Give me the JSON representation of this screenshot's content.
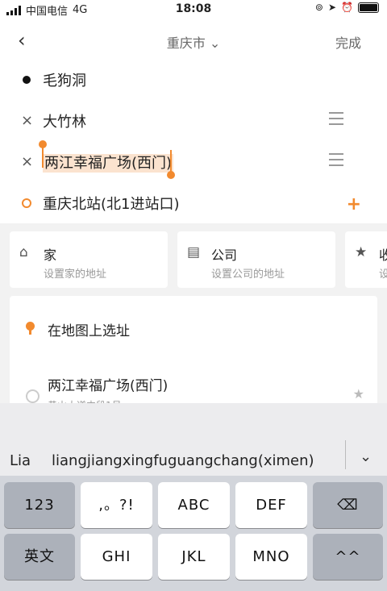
{
  "status_bar": {
    "carrier": "中国电信",
    "network": "4G",
    "time": "18:08"
  },
  "header": {
    "back_icon": "chevron-left-icon",
    "city": "重庆市",
    "city_chevron": "⌄",
    "done_label": "完成"
  },
  "route": {
    "origin": "毛狗洞",
    "waypoints": [
      "大竹林",
      "两江幸福广场(西门)"
    ],
    "destination": "重庆北站(北1进站口)",
    "remove_glyph": "×",
    "add_glyph": "+"
  },
  "shortcuts": [
    {
      "icon": "home-icon",
      "title": "家",
      "subtitle": "设置家的地址"
    },
    {
      "icon": "briefcase-icon",
      "title": "公司",
      "subtitle": "设置公司的地址"
    },
    {
      "icon": "star-icon",
      "title": "收",
      "subtitle": "设"
    }
  ],
  "panel": {
    "pick_on_map": "在地图上选址",
    "history_title": "两江幸福广场(西门)",
    "history_subtitle": "黄山大道中段1号"
  },
  "keyboard": {
    "pinyin_short": "Lia",
    "pinyin_full": "liangjiangxingfuguangchang(ximen)",
    "collapse_glyph": "⌄",
    "row1": [
      "123",
      ",。?!",
      "ABC",
      "DEF",
      "⌫"
    ],
    "row2": [
      "英文",
      "GHI",
      "JKL",
      "MNO",
      "^^"
    ]
  },
  "colors": {
    "accent": "#f28a2e",
    "highlight": "#fbe3cf"
  }
}
